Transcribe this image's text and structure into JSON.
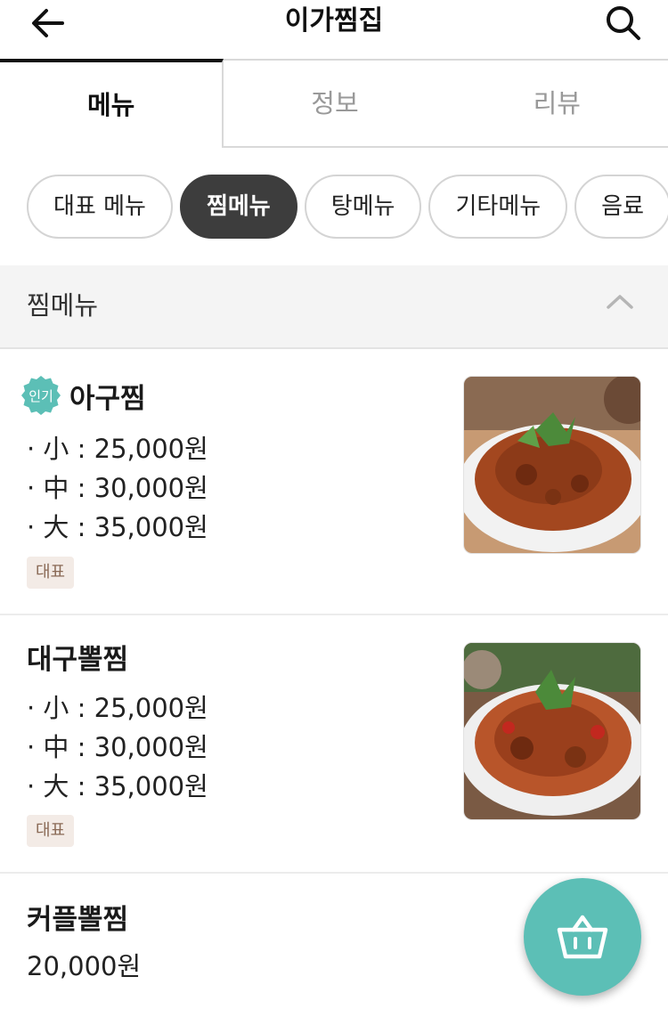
{
  "header": {
    "title": "이가찜집",
    "back_icon": "arrow-left-icon",
    "search_icon": "search-icon"
  },
  "tabs": [
    {
      "label": "메뉴",
      "active": true
    },
    {
      "label": "정보",
      "active": false
    },
    {
      "label": "리뷰",
      "active": false
    }
  ],
  "categories": [
    {
      "label": "대표 메뉴",
      "active": false
    },
    {
      "label": "찜메뉴",
      "active": true
    },
    {
      "label": "탕메뉴",
      "active": false
    },
    {
      "label": "기타메뉴",
      "active": false
    },
    {
      "label": "음료",
      "active": false
    }
  ],
  "section": {
    "title": "찜메뉴",
    "collapse_icon": "chevron-up-icon"
  },
  "items": [
    {
      "badge": "인기",
      "name": "아구찜",
      "prices": [
        "· 小 : 25,000원",
        "· 中 : 30,000원",
        "· 大 : 35,000원"
      ],
      "tag": "대표",
      "image": "braised-monkfish-photo"
    },
    {
      "name": "대구뽈찜",
      "prices": [
        "· 小 : 25,000원",
        "· 中 : 30,000원",
        "· 大 : 35,000원"
      ],
      "tag": "대표",
      "image": "braised-cod-cheek-photo"
    },
    {
      "name": "커플뽈찜",
      "price": "20,000원"
    }
  ],
  "cart": {
    "icon": "shopping-basket-icon",
    "color": "#5cbfb6"
  },
  "colors": {
    "accent": "#5cbfb6",
    "active_chip": "#3d3d3d",
    "tag_bg": "#f3ebe6",
    "tag_text": "#8a6a56"
  }
}
